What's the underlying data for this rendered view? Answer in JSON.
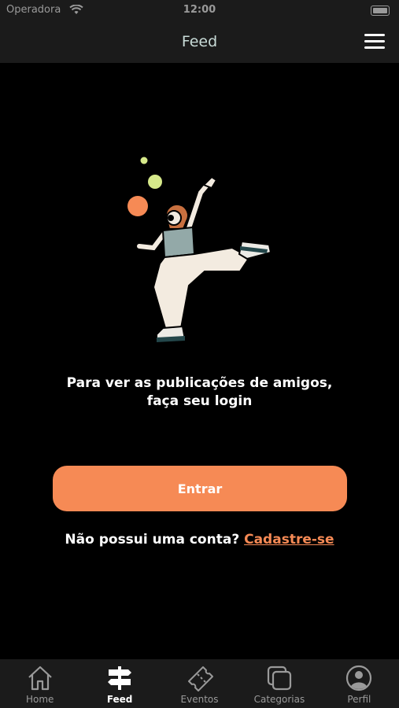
{
  "status_bar": {
    "carrier": "Operadora",
    "time": "12:00"
  },
  "header": {
    "title": "Feed",
    "menu_icon": "hamburger-menu-icon"
  },
  "main": {
    "message_line1": "Para ver as publicações de amigos,",
    "message_line2": "faça seu login",
    "login_button": "Entrar",
    "signup_prompt": "Não possui uma conta?",
    "signup_link": "Cadastre-se"
  },
  "tabs": [
    {
      "label": "Home",
      "icon": "home-icon"
    },
    {
      "label": "Feed",
      "icon": "signpost-icon",
      "active": true
    },
    {
      "label": "Eventos",
      "icon": "ticket-icon"
    },
    {
      "label": "Categorias",
      "icon": "stacked-squares-icon"
    },
    {
      "label": "Perfil",
      "icon": "user-circle-icon"
    }
  ],
  "colors": {
    "accent": "#f68a55",
    "background": "#000000",
    "bar": "#1b1b1b"
  }
}
